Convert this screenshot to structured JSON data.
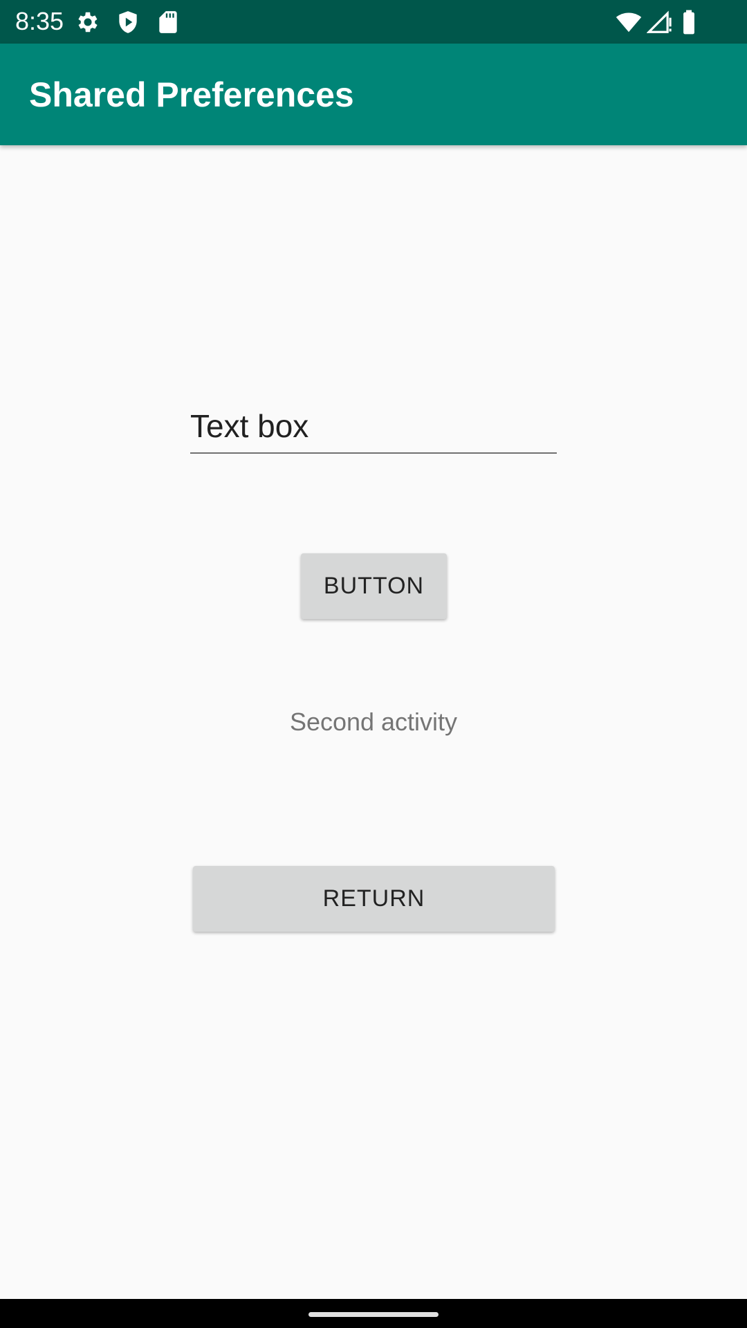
{
  "status_bar": {
    "time": "8:35",
    "icons": [
      "gear-icon",
      "shield-play-icon",
      "sd-card-icon",
      "wifi-icon",
      "signal-icon",
      "battery-icon"
    ]
  },
  "app_bar": {
    "title": "Shared Preferences"
  },
  "form": {
    "text_box_placeholder": "Text box",
    "button_label": "BUTTON",
    "second_activity_label": "Second activity",
    "return_label": "RETURN"
  },
  "colors": {
    "status_bar": "#00574b",
    "app_bar": "#008577",
    "background": "#fafafa",
    "button": "#d6d7d7"
  }
}
